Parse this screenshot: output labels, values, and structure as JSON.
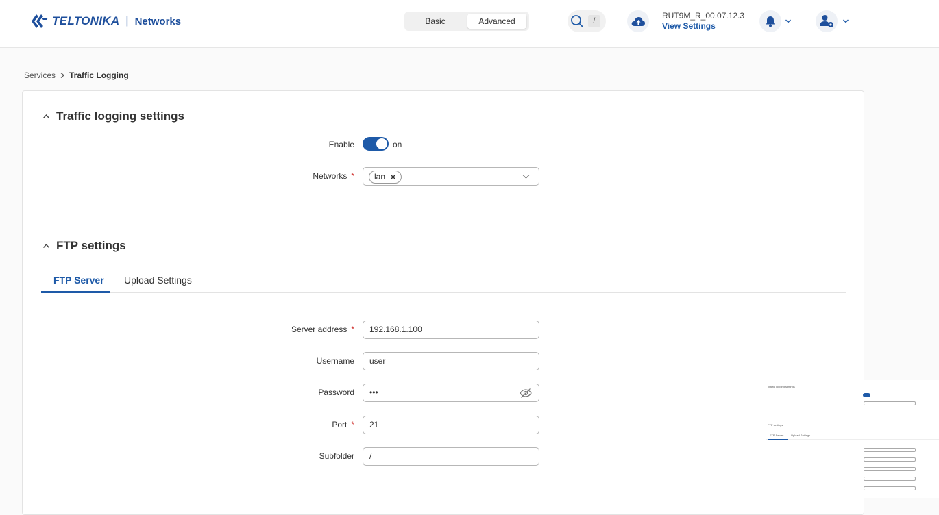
{
  "header": {
    "brand": "TELTONIKA",
    "brand_sep": "|",
    "brand_sub": "Networks",
    "mode_basic": "Basic",
    "mode_advanced": "Advanced",
    "search_key": "/",
    "device_name": "RUT9M_R_00.07.12.3",
    "device_link": "View Settings"
  },
  "breadcrumb": {
    "parent": "Services",
    "current": "Traffic Logging"
  },
  "traffic_section": {
    "title": "Traffic logging settings",
    "enable_label": "Enable",
    "enable_state": "on",
    "networks_label": "Networks",
    "networks_chip": "lan"
  },
  "ftp_section": {
    "title": "FTP settings",
    "tabs": [
      "FTP Server",
      "Upload Settings"
    ],
    "fields": {
      "server_label": "Server address",
      "server_value": "192.168.1.100",
      "username_label": "Username",
      "username_value": "user",
      "password_label": "Password",
      "password_value": "•••",
      "port_label": "Port",
      "port_value": "21",
      "subfolder_label": "Subfolder",
      "subfolder_value": "/"
    }
  },
  "thumbnail": {
    "title1": "Traffic logging settings",
    "title2": "FTP settings",
    "tab1": "FTP Server",
    "tab2": "Upload Settings"
  },
  "colors": {
    "accent": "#1e5aa8",
    "required": "#d0312d"
  }
}
